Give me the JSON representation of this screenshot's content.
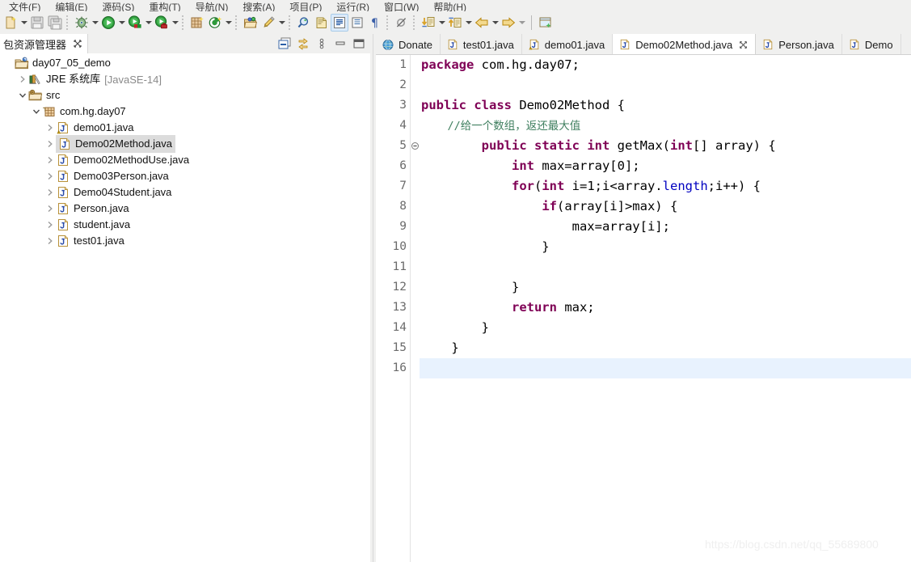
{
  "menu": {
    "items": [
      {
        "label": "文件(F)"
      },
      {
        "label": "编辑(E)"
      },
      {
        "label": "源码(S)"
      },
      {
        "label": "重构(T)"
      },
      {
        "label": "导航(N)"
      },
      {
        "label": "搜索(A)"
      },
      {
        "label": "项目(P)"
      },
      {
        "label": "运行(R)"
      },
      {
        "label": "窗口(W)"
      },
      {
        "label": "帮助(H)"
      }
    ]
  },
  "toolbar": {
    "items": [
      {
        "name": "new-wizard-icon",
        "kind": "icon"
      },
      {
        "name": "new-dropdown-caret",
        "kind": "caret"
      },
      {
        "name": "save-icon",
        "kind": "icon"
      },
      {
        "name": "save-all-icon",
        "kind": "icon"
      },
      {
        "name": "separator",
        "kind": "sep"
      },
      {
        "name": "debug-icon",
        "kind": "icon"
      },
      {
        "name": "debug-dropdown-caret",
        "kind": "caret"
      },
      {
        "name": "run-icon",
        "kind": "icon"
      },
      {
        "name": "run-dropdown-caret",
        "kind": "caret"
      },
      {
        "name": "coverage-icon",
        "kind": "icon"
      },
      {
        "name": "coverage-dropdown-caret",
        "kind": "caret"
      },
      {
        "name": "profile-icon",
        "kind": "icon"
      },
      {
        "name": "profile-dropdown-caret",
        "kind": "caret"
      },
      {
        "name": "separator",
        "kind": "sep"
      },
      {
        "name": "new-java-package-icon",
        "kind": "icon"
      },
      {
        "name": "new-java-class-icon",
        "kind": "icon"
      },
      {
        "name": "new-java-class-caret",
        "kind": "caret"
      },
      {
        "name": "separator",
        "kind": "sep"
      },
      {
        "name": "open-type-icon",
        "kind": "icon"
      },
      {
        "name": "quick-access-pen-icon",
        "kind": "icon"
      },
      {
        "name": "quick-access-caret",
        "kind": "caret"
      },
      {
        "name": "separator",
        "kind": "sep"
      },
      {
        "name": "search-icon",
        "kind": "icon"
      },
      {
        "name": "toggle-mark-occurrences-icon",
        "kind": "icon"
      },
      {
        "name": "link-editor-icon",
        "kind": "icon"
      },
      {
        "name": "show-whitespace-icon",
        "kind": "icon"
      },
      {
        "name": "pilcrow-icon",
        "kind": "icon"
      },
      {
        "name": "separator",
        "kind": "sep"
      },
      {
        "name": "skip-breakpoints-icon",
        "kind": "icon"
      },
      {
        "name": "separator",
        "kind": "sep"
      },
      {
        "name": "next-annotation-icon",
        "kind": "icon"
      },
      {
        "name": "next-annotation-caret",
        "kind": "caret"
      },
      {
        "name": "previous-annotation-icon",
        "kind": "icon"
      },
      {
        "name": "previous-annotation-caret",
        "kind": "caret"
      },
      {
        "name": "back-arrow-icon",
        "kind": "icon"
      },
      {
        "name": "back-arrow-caret",
        "kind": "caret"
      },
      {
        "name": "forward-arrow-icon",
        "kind": "icon"
      },
      {
        "name": "forward-arrow-caret",
        "kind": "caret"
      },
      {
        "name": "separator-line",
        "kind": "sep2"
      },
      {
        "name": "new-window-icon",
        "kind": "icon"
      }
    ]
  },
  "explorer": {
    "tab_title": "包资源管理器",
    "close_glyph": "✖",
    "tools": [
      {
        "name": "collapse-all-icon"
      },
      {
        "name": "link-with-editor-icon"
      },
      {
        "name": "view-menu-icon"
      },
      {
        "name": "minimize-icon"
      },
      {
        "name": "maximize-icon"
      }
    ],
    "tree": [
      {
        "label": "day07_05_demo",
        "sub": "",
        "indent": 0,
        "twist": "none",
        "icon": "java-project-icon",
        "selected": false
      },
      {
        "label": "JRE 系统库",
        "sub": "[JavaSE-14]",
        "indent": 1,
        "twist": "collapsed",
        "icon": "jre-library-icon",
        "selected": false
      },
      {
        "label": "src",
        "sub": "",
        "indent": 1,
        "twist": "expanded",
        "icon": "source-folder-icon",
        "selected": false
      },
      {
        "label": "com.hg.day07",
        "sub": "",
        "indent": 2,
        "twist": "expanded",
        "icon": "package-icon",
        "selected": false
      },
      {
        "label": "demo01.java",
        "sub": "",
        "indent": 3,
        "twist": "collapsed",
        "icon": "java-file-warning-icon",
        "selected": false
      },
      {
        "label": "Demo02Method.java",
        "sub": "",
        "indent": 3,
        "twist": "collapsed",
        "icon": "java-file-icon",
        "selected": true
      },
      {
        "label": "Demo02MethodUse.java",
        "sub": "",
        "indent": 3,
        "twist": "collapsed",
        "icon": "java-file-icon",
        "selected": false
      },
      {
        "label": "Demo03Person.java",
        "sub": "",
        "indent": 3,
        "twist": "collapsed",
        "icon": "java-file-icon",
        "selected": false
      },
      {
        "label": "Demo04Student.java",
        "sub": "",
        "indent": 3,
        "twist": "collapsed",
        "icon": "java-file-icon",
        "selected": false
      },
      {
        "label": "Person.java",
        "sub": "",
        "indent": 3,
        "twist": "collapsed",
        "icon": "java-file-icon",
        "selected": false
      },
      {
        "label": "student.java",
        "sub": "",
        "indent": 3,
        "twist": "collapsed",
        "icon": "java-file-icon",
        "selected": false
      },
      {
        "label": "test01.java",
        "sub": "",
        "indent": 3,
        "twist": "collapsed",
        "icon": "java-file-icon",
        "selected": false
      }
    ]
  },
  "editor": {
    "tabs": [
      {
        "label": "Donate",
        "icon": "globe-icon",
        "active": false,
        "closable": false
      },
      {
        "label": "test01.java",
        "icon": "java-file-icon",
        "active": false,
        "closable": false
      },
      {
        "label": "demo01.java",
        "icon": "java-file-warning-icon",
        "active": false,
        "closable": false
      },
      {
        "label": "Demo02Method.java",
        "icon": "java-file-icon",
        "active": true,
        "closable": true
      },
      {
        "label": "Person.java",
        "icon": "java-file-icon",
        "active": false,
        "closable": false
      },
      {
        "label": "Demo",
        "icon": "java-file-icon",
        "active": false,
        "closable": false
      }
    ],
    "tab_close_glyph": "✖",
    "lines": [
      {
        "n": "1",
        "fold": false,
        "current": false,
        "tokens": [
          {
            "t": "package",
            "c": "kw"
          },
          {
            "t": " com.hg.day07;",
            "c": ""
          }
        ]
      },
      {
        "n": "2",
        "fold": false,
        "current": false,
        "tokens": []
      },
      {
        "n": "3",
        "fold": false,
        "current": false,
        "tokens": [
          {
            "t": "public",
            "c": "kw"
          },
          {
            "t": " ",
            "c": ""
          },
          {
            "t": "class",
            "c": "kw"
          },
          {
            "t": " Demo02Method {",
            "c": ""
          }
        ]
      },
      {
        "n": "4",
        "fold": false,
        "current": false,
        "tokens": [
          {
            "t": "    //给一个数组，返还最大值",
            "c": "cm"
          }
        ]
      },
      {
        "n": "5",
        "fold": true,
        "current": false,
        "tokens": [
          {
            "t": "        ",
            "c": ""
          },
          {
            "t": "public",
            "c": "kw"
          },
          {
            "t": " ",
            "c": ""
          },
          {
            "t": "static",
            "c": "kw"
          },
          {
            "t": " ",
            "c": ""
          },
          {
            "t": "int",
            "c": "kw"
          },
          {
            "t": " getMax(",
            "c": ""
          },
          {
            "t": "int",
            "c": "kw"
          },
          {
            "t": "[] array) {",
            "c": ""
          }
        ]
      },
      {
        "n": "6",
        "fold": false,
        "current": false,
        "tokens": [
          {
            "t": "            ",
            "c": ""
          },
          {
            "t": "int",
            "c": "kw"
          },
          {
            "t": " max=array[0];",
            "c": ""
          }
        ]
      },
      {
        "n": "7",
        "fold": false,
        "current": false,
        "tokens": [
          {
            "t": "            ",
            "c": ""
          },
          {
            "t": "for",
            "c": "kw"
          },
          {
            "t": "(",
            "c": ""
          },
          {
            "t": "int",
            "c": "kw"
          },
          {
            "t": " i=1;i<array.",
            "c": ""
          },
          {
            "t": "length",
            "c": "fld"
          },
          {
            "t": ";i++) {",
            "c": ""
          }
        ]
      },
      {
        "n": "8",
        "fold": false,
        "current": false,
        "tokens": [
          {
            "t": "                ",
            "c": ""
          },
          {
            "t": "if",
            "c": "kw"
          },
          {
            "t": "(array[i]>max) {",
            "c": ""
          }
        ]
      },
      {
        "n": "9",
        "fold": false,
        "current": false,
        "tokens": [
          {
            "t": "                    max=array[i];",
            "c": ""
          }
        ]
      },
      {
        "n": "10",
        "fold": false,
        "current": false,
        "tokens": [
          {
            "t": "                }",
            "c": ""
          }
        ]
      },
      {
        "n": "11",
        "fold": false,
        "current": false,
        "tokens": []
      },
      {
        "n": "12",
        "fold": false,
        "current": false,
        "tokens": [
          {
            "t": "            }",
            "c": ""
          }
        ]
      },
      {
        "n": "13",
        "fold": false,
        "current": false,
        "tokens": [
          {
            "t": "            ",
            "c": ""
          },
          {
            "t": "return",
            "c": "kw"
          },
          {
            "t": " max;",
            "c": ""
          }
        ]
      },
      {
        "n": "14",
        "fold": false,
        "current": false,
        "tokens": [
          {
            "t": "        }",
            "c": ""
          }
        ]
      },
      {
        "n": "15",
        "fold": false,
        "current": false,
        "tokens": [
          {
            "t": "    }",
            "c": ""
          }
        ]
      },
      {
        "n": "16",
        "fold": false,
        "current": true,
        "tokens": []
      }
    ]
  },
  "watermark": {
    "text": "https://blog.csdn.net/qq_55689800"
  },
  "colors": {
    "keyword": "#7f0055",
    "comment": "#3f7f5f",
    "field": "#0000c0",
    "current_line": "#e8f2fe",
    "selection": "#dcdcdc",
    "chrome": "#f0f0ef"
  }
}
